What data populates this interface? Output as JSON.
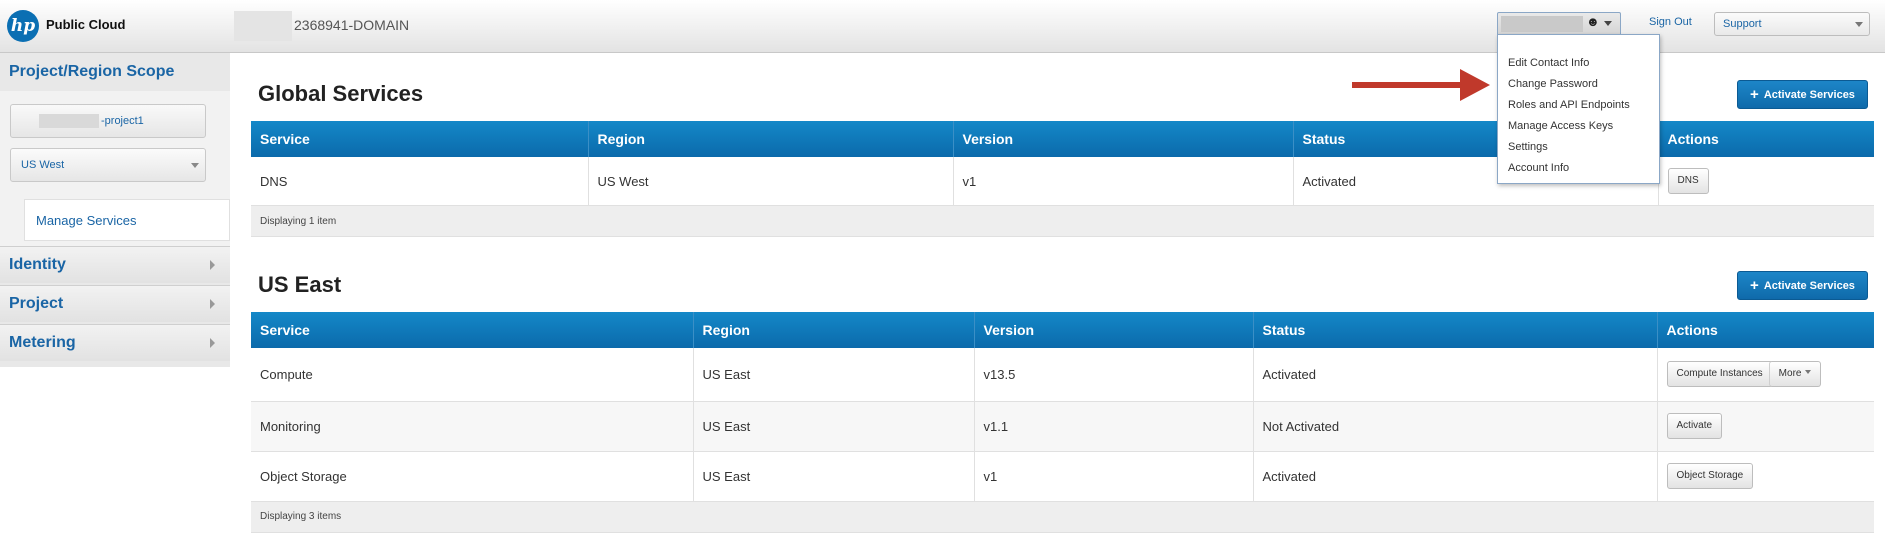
{
  "header": {
    "logo_mark": "hp",
    "logo_text": "Public Cloud",
    "domain": "2368941-DOMAIN",
    "user_icon": "user-icon",
    "signout": "Sign Out",
    "support": "Support"
  },
  "account_menu": {
    "items": [
      "Edit Contact Info",
      "Change Password",
      "Roles and API Endpoints",
      "Manage Access Keys",
      "Settings",
      "Account Info"
    ],
    "arrow_color": "#c0392b"
  },
  "sidebar": {
    "scope_title": "Project/Region Scope",
    "project_value": "-project1",
    "region_value": "US West",
    "manage_services": "Manage Services",
    "nav": [
      "Identity",
      "Project",
      "Metering"
    ]
  },
  "global": {
    "title": "Global Services",
    "activate_label": "Activate Services",
    "columns": [
      "Service",
      "Region",
      "Version",
      "Status",
      "Actions"
    ],
    "rows": [
      {
        "service": "DNS",
        "region": "US West",
        "version": "v1",
        "status": "Activated",
        "action": "DNS"
      }
    ],
    "footer": "Displaying 1 item"
  },
  "useast": {
    "title": "US East",
    "activate_label": "Activate Services",
    "columns": [
      "Service",
      "Region",
      "Version",
      "Status",
      "Actions"
    ],
    "rows": [
      {
        "service": "Compute",
        "region": "US East",
        "version": "v13.5",
        "status": "Activated",
        "action": "Compute Instances",
        "more": "More"
      },
      {
        "service": "Monitoring",
        "region": "US East",
        "version": "v1.1",
        "status": "Not Activated",
        "action": "Activate"
      },
      {
        "service": "Object Storage",
        "region": "US East",
        "version": "v1",
        "status": "Activated",
        "action": "Object Storage"
      }
    ],
    "footer": "Displaying 3 items"
  },
  "colors": {
    "accent": "#1488c8",
    "link": "#1a65a5",
    "header_bg": "#e3e3e3"
  }
}
